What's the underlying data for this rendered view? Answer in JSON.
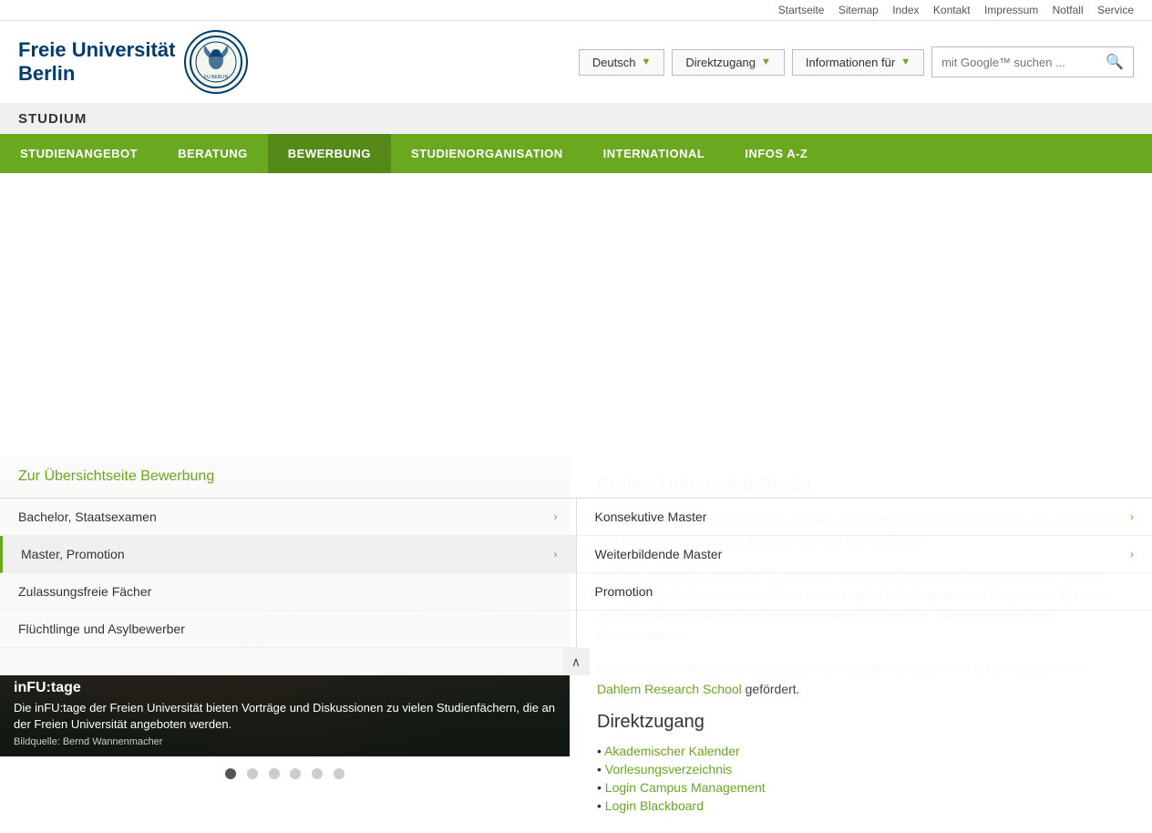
{
  "topbar": {
    "links": [
      "Startseite",
      "Sitemap",
      "Index",
      "Kontakt",
      "Impressum",
      "Notfall",
      "Service"
    ]
  },
  "header": {
    "logo_line1": "Freie Universität",
    "logo_line2": "Berlin",
    "lang_btn": "Deutsch",
    "direktzugang_btn": "Direktzugang",
    "info_btn": "Informationen für",
    "search_placeholder": "mit Google™ suchen ..."
  },
  "studium_bar": {
    "label": "STUDIUM"
  },
  "nav": {
    "items": [
      "STUDIENANGEBOT",
      "BERATUNG",
      "BEWERBUNG",
      "STUDIENORGANISATION",
      "INTERNATIONAL",
      "INFOS A-Z"
    ]
  },
  "dropdown": {
    "header": "Zur Übersichtseite Bewerbung",
    "col1": [
      {
        "label": "Bachelor, Staatsexamen",
        "chevron": true,
        "highlighted": false
      },
      {
        "label": "Master, Promotion",
        "chevron": true,
        "highlighted": true
      },
      {
        "label": "Zulassungsfreie Fächer",
        "chevron": false,
        "highlighted": false
      },
      {
        "label": "Flüchtlinge und Asylbewerber",
        "chevron": false,
        "highlighted": false
      }
    ],
    "col2": [
      {
        "label": "Konsekutive Master",
        "chevron": true,
        "highlighted": false
      },
      {
        "label": "Weiterbildende Master",
        "chevron": true,
        "highlighted": false
      },
      {
        "label": "Promotion",
        "chevron": false,
        "highlighted": false
      }
    ]
  },
  "image_section": {
    "title": "inFU:tage",
    "desc": "Die inFU:tage der Freien Universität bieten Vorträge und Diskussionen zu vielen Studienfächern, die an der Freien Universität angeboten werden.",
    "credit": "Bildquelle: Bernd Wannenmacher",
    "dots": [
      true,
      false,
      false,
      false,
      false,
      false
    ]
  },
  "right_panel": {
    "heading": "Freien Universität Berlin",
    "para1": "bietet mehr als 150 Studiengänge in allen universitäre Info-Service Studium, der jährlich rund 250 000 imiert umfassend vor und während des Studiums",
    "para2_prefix": "Die ",
    "para2_link": "Austauschprogramme für Studierende",
    "para2_mid": " spielen seit jeher eine besondere Rolle. Derzeit beteiligt sich die Freie Universität an den europäischen Programmen Tempus und Erasmus und unterhält mit zahlreichen hervorragenden",
    "para2_link2": "Universitäten",
    "para2_end": " Vereinbarungen zum Direktaustausch.",
    "para3_prefix": "Der wissenschaftliche Nachwuchs wird in Promotionsprogrammen unter dem Dach der ",
    "para3_link": "Dahlem Research School",
    "para3_end": " gefördert.",
    "direktzugang_heading": "Direktzugang",
    "links": [
      {
        "label": "Akademischer Kalender",
        "href": "#"
      },
      {
        "label": "Vorlesungsverzeichnis",
        "href": "#"
      },
      {
        "label": "Login Campus Management",
        "href": "#"
      },
      {
        "label": "Login Blackboard",
        "href": "#"
      }
    ]
  }
}
